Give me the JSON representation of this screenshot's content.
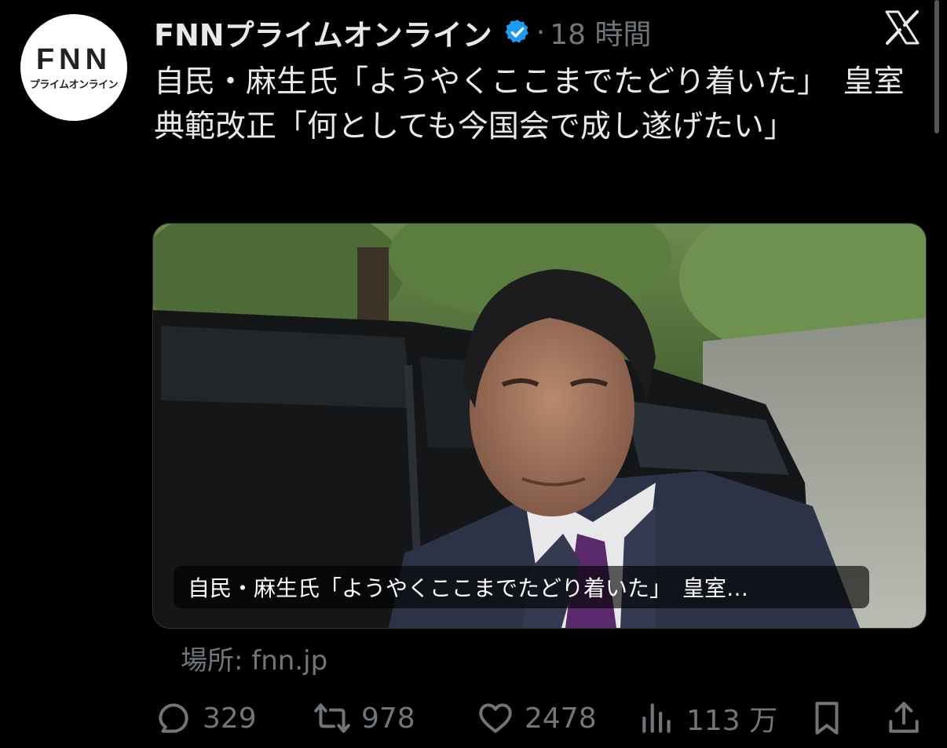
{
  "tweet": {
    "author": {
      "name": "FNNプライムオンライン",
      "verified": true,
      "avatar_text_main": "FNN",
      "avatar_text_sub": "プライムオンライン"
    },
    "separator": "·",
    "time": "18 時間",
    "text": "自民・麻生氏「ようやくここまでたどり着いた」　皇室典範改正「何としても今国会で成し遂げたい」",
    "card": {
      "overlay_title": "自民・麻生氏「ようやくここまでたどり着いた」　皇室…",
      "source_label": "場所: fnn.jp"
    },
    "stats": {
      "replies": "329",
      "reposts": "978",
      "likes": "2478",
      "views": "113 万"
    },
    "icons": [
      "verified-badge-icon",
      "x-logo-icon",
      "reply-icon",
      "repost-icon",
      "like-icon",
      "views-icon",
      "bookmark-icon",
      "share-icon"
    ],
    "colors": {
      "background": "#000000",
      "text": "#e7e9ea",
      "muted": "#71767b",
      "verified": "#1d9bf0"
    }
  }
}
